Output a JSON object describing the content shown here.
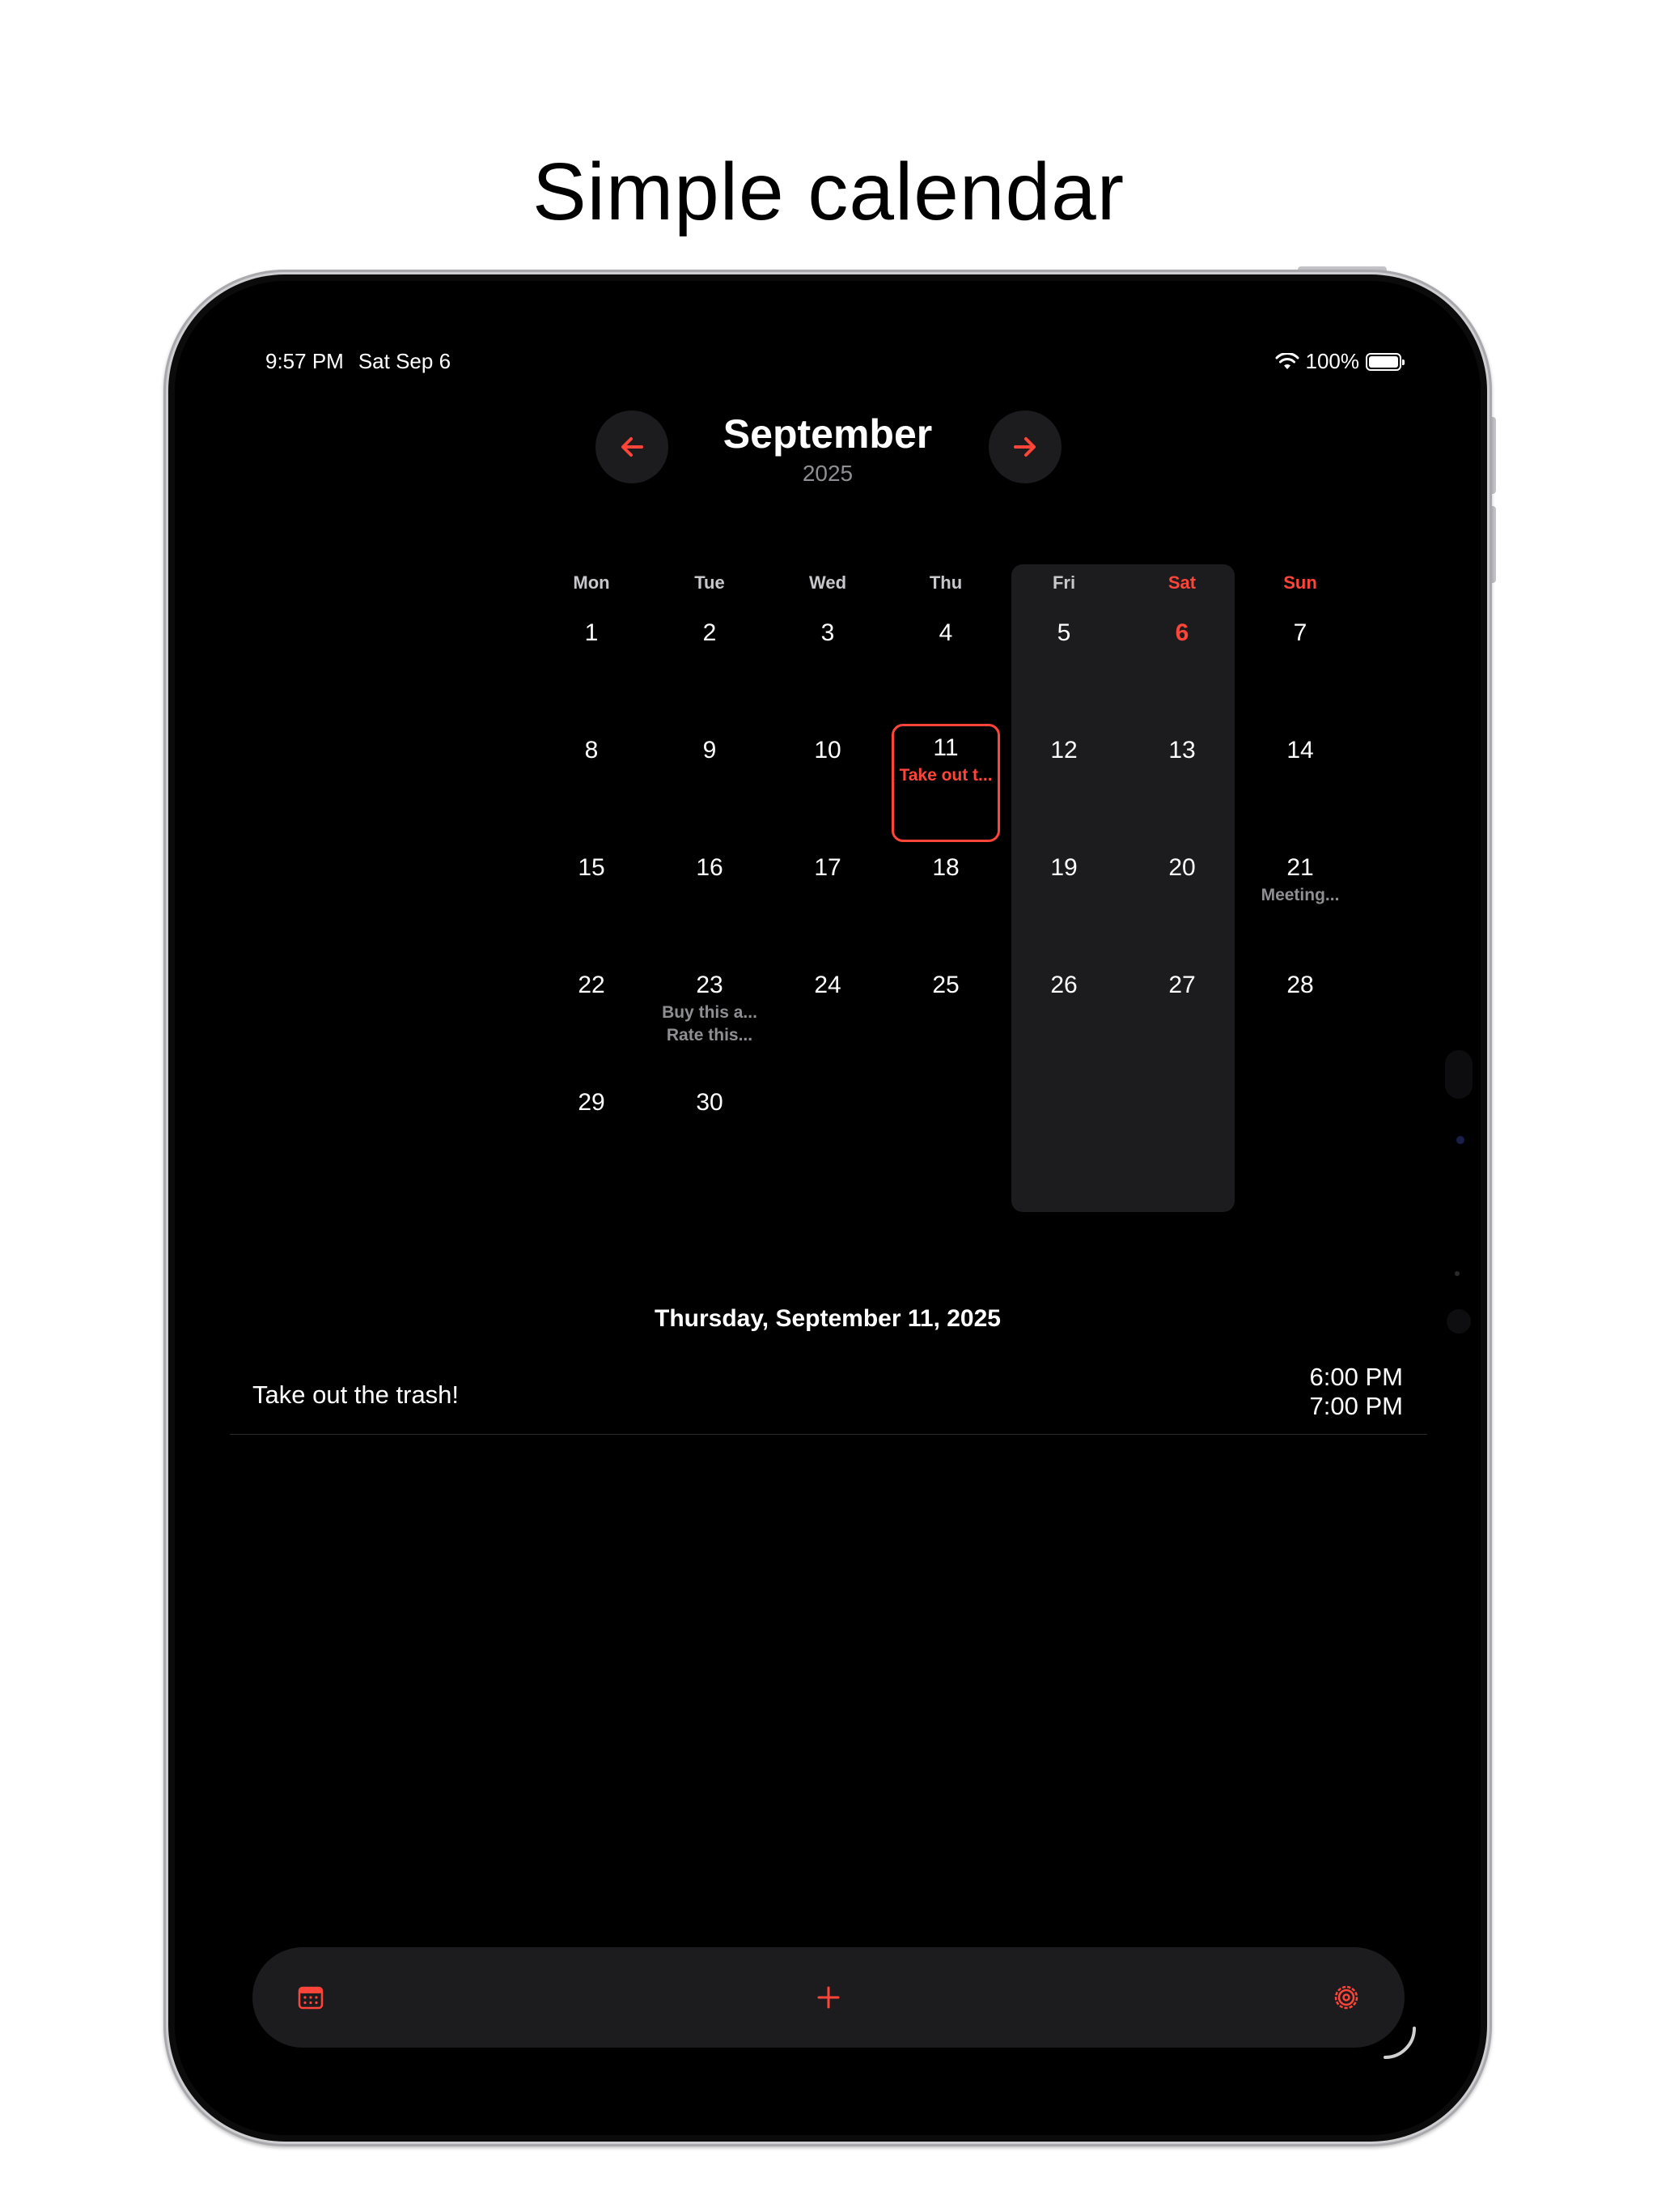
{
  "headline": "Simple calendar",
  "status_bar": {
    "time": "9:57 PM",
    "date": "Sat Sep 6",
    "battery": "100%"
  },
  "header": {
    "month": "September",
    "year": "2025"
  },
  "weekdays": [
    "Mon",
    "Tue",
    "Wed",
    "Thu",
    "Fri",
    "Sat",
    "Sun"
  ],
  "days": [
    {
      "n": "1",
      "events": []
    },
    {
      "n": "2",
      "events": []
    },
    {
      "n": "3",
      "events": []
    },
    {
      "n": "4",
      "events": []
    },
    {
      "n": "5",
      "events": []
    },
    {
      "n": "6",
      "events": [],
      "today": true
    },
    {
      "n": "7",
      "events": []
    },
    {
      "n": "8",
      "events": []
    },
    {
      "n": "9",
      "events": []
    },
    {
      "n": "10",
      "events": []
    },
    {
      "n": "11",
      "events": [
        "Take out t..."
      ],
      "selected": true
    },
    {
      "n": "12",
      "events": []
    },
    {
      "n": "13",
      "events": []
    },
    {
      "n": "14",
      "events": []
    },
    {
      "n": "15",
      "events": []
    },
    {
      "n": "16",
      "events": []
    },
    {
      "n": "17",
      "events": []
    },
    {
      "n": "18",
      "events": []
    },
    {
      "n": "19",
      "events": []
    },
    {
      "n": "20",
      "events": []
    },
    {
      "n": "21",
      "events": [
        "Meeting..."
      ]
    },
    {
      "n": "22",
      "events": []
    },
    {
      "n": "23",
      "events": [
        "Buy this a...",
        "Rate this..."
      ]
    },
    {
      "n": "24",
      "events": []
    },
    {
      "n": "25",
      "events": []
    },
    {
      "n": "26",
      "events": []
    },
    {
      "n": "27",
      "events": []
    },
    {
      "n": "28",
      "events": []
    },
    {
      "n": "29",
      "events": []
    },
    {
      "n": "30",
      "events": []
    }
  ],
  "selected_date": "Thursday, September 11, 2025",
  "event": {
    "title": "Take out the trash!",
    "start": "6:00 PM",
    "end": "7:00 PM"
  },
  "colors": {
    "accent": "#ff453a",
    "background": "#000000",
    "surface": "#1c1c1e",
    "secondary_text": "#8e8e93"
  },
  "icons": {
    "prev": "arrow-left-icon",
    "next": "arrow-right-icon",
    "calendar": "calendar-icon",
    "add": "plus-icon",
    "settings": "gear-icon"
  }
}
